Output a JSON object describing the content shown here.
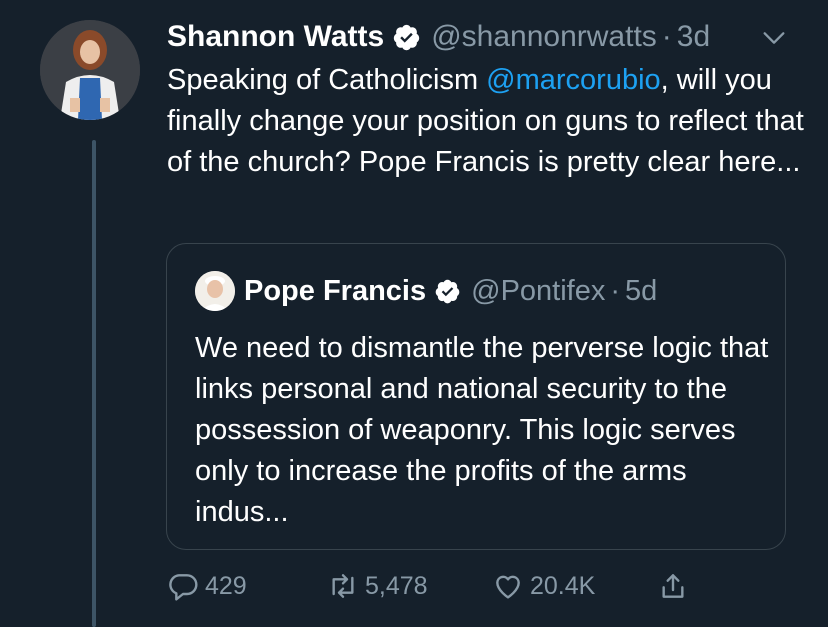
{
  "tweet": {
    "author_name": "Shannon Watts",
    "author_handle": "@shannonrwatts",
    "separator": "·",
    "time": "3d",
    "text_before_mention": "Speaking of Catholicism ",
    "mention": "@marcorubio",
    "text_after_mention": ", will you finally change your position on guns to reflect that of the church? Pope Francis is pretty clear here..."
  },
  "quote": {
    "author_name": "Pope Francis",
    "author_handle": "@Pontifex",
    "separator": "·",
    "time": "5d",
    "text": "We need to dismantle the perverse logic that links personal and national security to the possession of weaponry. This logic serves only to increase the profits of the arms indus..."
  },
  "actions": {
    "replies": "429",
    "retweets": "5,478",
    "likes": "20.4K"
  },
  "colors": {
    "background": "#15202b",
    "secondary_text": "#8899a6",
    "link": "#1da1f2",
    "border": "#38444d"
  },
  "icons": [
    "verified-badge-icon",
    "chevron-down-icon",
    "reply-icon",
    "retweet-icon",
    "like-icon",
    "share-icon"
  ]
}
